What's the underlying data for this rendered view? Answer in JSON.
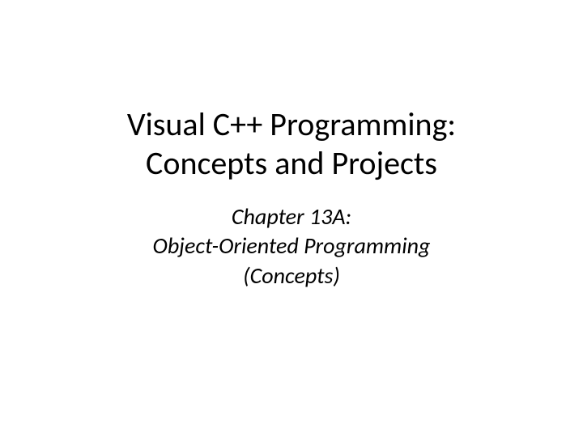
{
  "slide": {
    "title_line1": "Visual C++ Programming:",
    "title_line2": "Concepts and Projects",
    "subtitle_line1": "Chapter 13A:",
    "subtitle_line2": "Object-Oriented Programming",
    "subtitle_line3": "(Concepts)"
  }
}
